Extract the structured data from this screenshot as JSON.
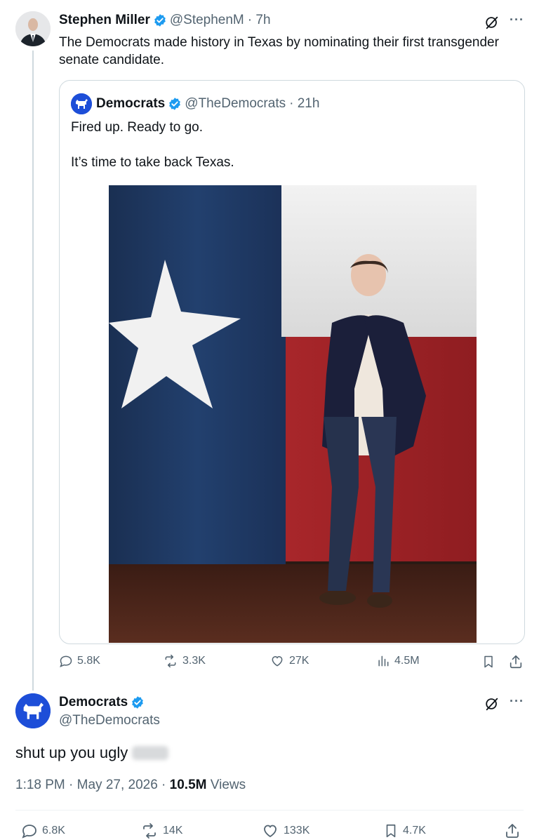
{
  "tweet": {
    "author_name": "Stephen Miller",
    "author_handle": "@StephenM",
    "time": "· 7h",
    "text": "The Democrats made history in Texas by nominating their first transgender senate candidate."
  },
  "quoted": {
    "author_name": "Democrats",
    "author_handle": "@TheDemocrats",
    "time": "· 21h",
    "line1": "Fired up. Ready to go.",
    "line2": "It’s time to take back Texas."
  },
  "tweet_actions": {
    "replies": "5.8K",
    "reposts": "3.3K",
    "likes": "27K",
    "views": "4.5M"
  },
  "reply": {
    "author_name": "Democrats",
    "author_handle": "@TheDemocrats",
    "text": "shut up you ugly",
    "time": "1:18 PM · May 27, 2026 ·",
    "views_count": "10.5M",
    "views_label": "Views"
  },
  "reply_actions": {
    "replies": "6.8K",
    "reposts": "14K",
    "likes": "133K",
    "bookmarks": "4.7K"
  },
  "colors": {
    "verified": "#1d9bf0",
    "text_primary": "#0f1419",
    "text_secondary": "#536471",
    "border": "#cfd9de",
    "democrats_blue": "#1d4ed8"
  }
}
